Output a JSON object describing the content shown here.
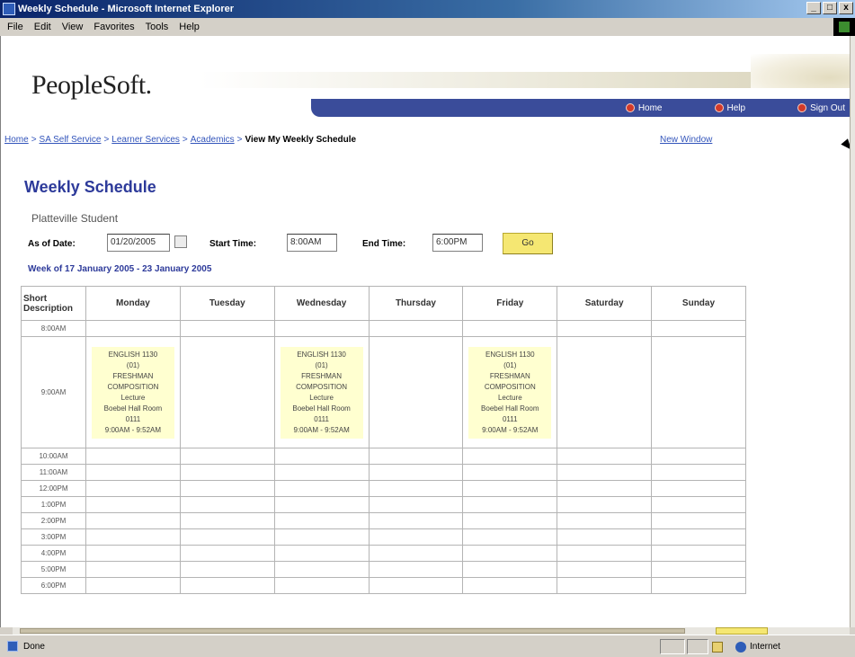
{
  "window": {
    "title": "Weekly Schedule - Microsoft Internet Explorer",
    "minimize": "_",
    "maximize": "□",
    "close": "x"
  },
  "menu": [
    "File",
    "Edit",
    "View",
    "Favorites",
    "Tools",
    "Help"
  ],
  "header": {
    "logo": "PeopleSoft.",
    "nav": [
      "Home",
      "Help",
      "Sign Out"
    ]
  },
  "breadcrumb": {
    "links": [
      "Home",
      "SA Self Service",
      "Learner Services",
      "Academics"
    ],
    "separator": ">",
    "current": "View My Weekly Schedule",
    "new_window": "New Window"
  },
  "page": {
    "title": "Weekly Schedule",
    "student": "Platteville Student"
  },
  "filters": {
    "as_of_label": "As of Date:",
    "as_of_value": "01/20/2005",
    "start_label": "Start Time:",
    "start_value": "8:00AM",
    "end_label": "End Time:",
    "end_value": "6:00PM",
    "go_label": "Go"
  },
  "week_of": "Week of 17 January 2005 - 23 January 2005",
  "schedule": {
    "desc_header": "Short Description",
    "days": [
      "Monday",
      "Tuesday",
      "Wednesday",
      "Thursday",
      "Friday",
      "Saturday",
      "Sunday"
    ],
    "times": [
      "8:00AM",
      "9:00AM",
      "10:00AM",
      "11:00AM",
      "12:00PM",
      "1:00PM",
      "2:00PM",
      "3:00PM",
      "4:00PM",
      "5:00PM",
      "6:00PM"
    ],
    "event": {
      "course": "ENGLISH 1130",
      "section": "(01)",
      "title_line1": "FRESHMAN",
      "title_line2": "COMPOSITION",
      "type": "Lecture",
      "room_line1": "Boebel Hall Room",
      "room_line2": "0111",
      "time": "9:00AM - 9:52AM",
      "days": [
        "Monday",
        "Wednesday",
        "Friday"
      ]
    }
  },
  "status": {
    "text": "Done",
    "zone": "Internet"
  },
  "colors": {
    "title_blue": "#2d3a9a",
    "nav_bar": "#3a4c9a",
    "event_bg": "#ffffd0",
    "go_button": "#f5e772"
  }
}
